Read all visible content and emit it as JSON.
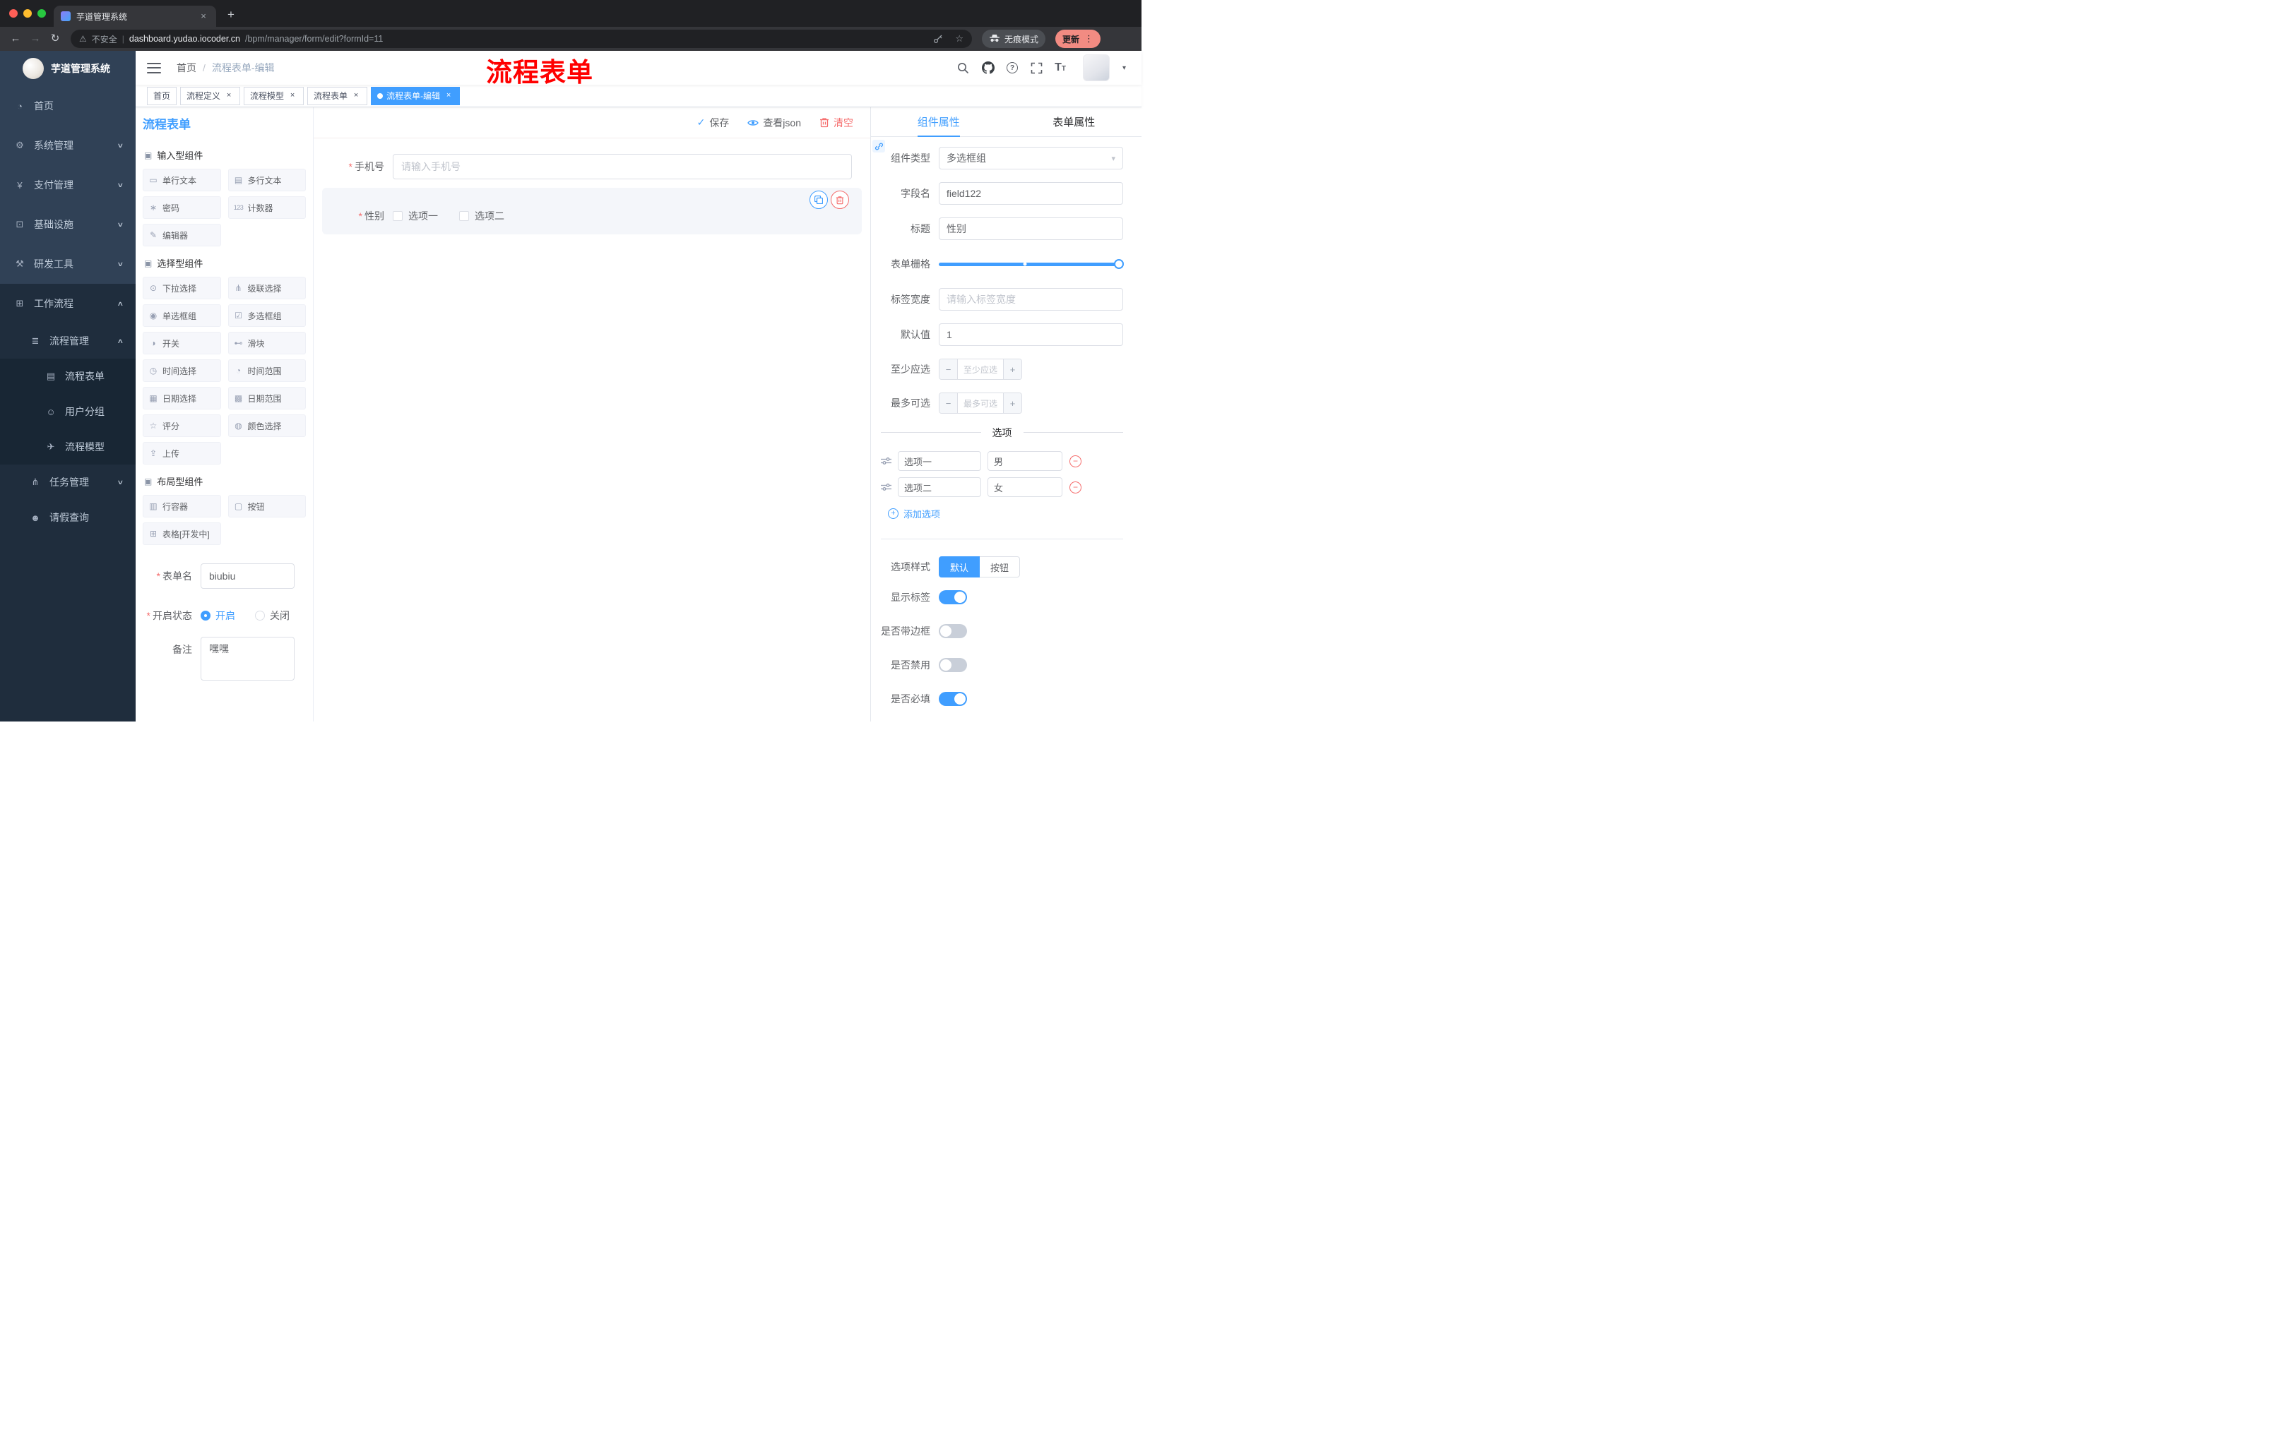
{
  "browser": {
    "tab_title": "芋道管理系统",
    "security_label": "不安全",
    "url_host": "dashboard.yudao.iocoder.cn",
    "url_path": "/bpm/manager/form/edit?formId=11",
    "incognito_label": "无痕模式",
    "update_label": "更新"
  },
  "annotation": {
    "text": "流程表单",
    "color": "#ff0000"
  },
  "icons": {
    "back": "←",
    "forward": "→",
    "reload": "↻",
    "new_tab": "+",
    "tab_close": "×",
    "tag_close": "×",
    "warning": "⚠",
    "star": "☆",
    "kebab": "⋮",
    "chevron_down": "∨",
    "chevron_up": "∧",
    "select_caret": "▾",
    "avatar_caret": "▾",
    "question": "?",
    "font_size_big": "T",
    "font_size_small": "T",
    "check": "✓",
    "minus": "−",
    "plus": "+",
    "group_marker": "▣",
    "url_divider": "|"
  },
  "sidebar": {
    "logo_title": "芋道管理系统",
    "items": [
      {
        "label": "首页",
        "icon": "dashboard-icon",
        "glyph": "◔"
      },
      {
        "label": "系统管理",
        "icon": "gear-icon",
        "glyph": "⚙"
      },
      {
        "label": "支付管理",
        "icon": "payment-icon",
        "glyph": "¥"
      },
      {
        "label": "基础设施",
        "icon": "infrastructure-icon",
        "glyph": "⊡"
      },
      {
        "label": "研发工具",
        "icon": "devtools-icon",
        "glyph": "⚒"
      },
      {
        "label": "工作流程",
        "icon": "workflow-icon",
        "glyph": "⊞"
      },
      {
        "label": "流程管理",
        "icon": "process-manage-icon",
        "glyph": "≣"
      },
      {
        "label": "流程表单",
        "icon": "process-form-icon",
        "glyph": "▤",
        "active": true
      },
      {
        "label": "用户分组",
        "icon": "user-group-icon",
        "glyph": "☺"
      },
      {
        "label": "流程模型",
        "icon": "process-model-icon",
        "glyph": "✈"
      },
      {
        "label": "任务管理",
        "icon": "task-manage-icon",
        "glyph": "⋔"
      },
      {
        "label": "请假查询",
        "icon": "leave-query-icon",
        "glyph": "☻"
      }
    ]
  },
  "breadcrumb": {
    "root": "首页",
    "separator": "/",
    "current": "流程表单-编辑"
  },
  "tags": [
    {
      "label": "首页",
      "closable": false,
      "active": false
    },
    {
      "label": "流程定义",
      "closable": true,
      "active": false
    },
    {
      "label": "流程模型",
      "closable": true,
      "active": false
    },
    {
      "label": "流程表单",
      "closable": true,
      "active": false
    },
    {
      "label": "流程表单-编辑",
      "closable": true,
      "active": true
    }
  ],
  "designer": {
    "panel_title": "流程表单",
    "actions": {
      "save": "保存",
      "view_json": "查看json",
      "clear": "清空"
    },
    "library": {
      "groups": [
        {
          "title": "输入型组件",
          "items": [
            {
              "label": "单行文本",
              "icon": "single-line-text-icon",
              "glyph": "▭"
            },
            {
              "label": "多行文本",
              "icon": "textarea-icon",
              "glyph": "▤"
            },
            {
              "label": "密码",
              "icon": "password-icon",
              "glyph": "∗"
            },
            {
              "label": "计数器",
              "icon": "counter-icon",
              "glyph": "123"
            },
            {
              "label": "编辑器",
              "icon": "editor-icon",
              "glyph": "✎"
            }
          ]
        },
        {
          "title": "选择型组件",
          "items": [
            {
              "label": "下拉选择",
              "icon": "select-icon",
              "glyph": "⊙"
            },
            {
              "label": "级联选择",
              "icon": "cascader-icon",
              "glyph": "⋔"
            },
            {
              "label": "单选框组",
              "icon": "radio-group-icon",
              "glyph": "◉"
            },
            {
              "label": "多选框组",
              "icon": "checkbox-group-icon",
              "glyph": "☑"
            },
            {
              "label": "开关",
              "icon": "switch-icon",
              "glyph": "◑"
            },
            {
              "label": "滑块",
              "icon": "slider-icon",
              "glyph": "⊷"
            },
            {
              "label": "时间选择",
              "icon": "time-picker-icon",
              "glyph": "◷"
            },
            {
              "label": "时间范围",
              "icon": "time-range-icon",
              "glyph": "◔"
            },
            {
              "label": "日期选择",
              "icon": "date-picker-icon",
              "glyph": "▦"
            },
            {
              "label": "日期范围",
              "icon": "date-range-icon",
              "glyph": "▩"
            },
            {
              "label": "评分",
              "icon": "rate-icon",
              "glyph": "☆"
            },
            {
              "label": "颜色选择",
              "icon": "color-picker-icon",
              "glyph": "◍"
            },
            {
              "label": "上传",
              "icon": "upload-icon",
              "glyph": "⇪"
            }
          ]
        },
        {
          "title": "布局型组件",
          "items": [
            {
              "label": "行容器",
              "icon": "row-container-icon",
              "glyph": "▥"
            },
            {
              "label": "按钮",
              "icon": "button-icon",
              "glyph": "▢"
            },
            {
              "label": "表格[开发中]",
              "icon": "table-icon",
              "glyph": "⊞"
            }
          ]
        }
      ]
    },
    "meta": {
      "required_mark": "*",
      "form_name_label": "表单名",
      "form_name_value": "biubiu",
      "status_label": "开启状态",
      "status_on": "开启",
      "status_off": "关闭",
      "remark_label": "备注",
      "remark_value": "嘿嘿"
    },
    "canvas": {
      "phone_label": "手机号",
      "phone_placeholder": "请输入手机号",
      "gender_label": "性别",
      "gender_options": [
        "选项一",
        "选项二"
      ]
    }
  },
  "props": {
    "tab_component": "组件属性",
    "tab_form": "表单属性",
    "component_type_label": "组件类型",
    "component_type_value": "多选框组",
    "field_name_label": "字段名",
    "field_name_value": "field122",
    "title_label": "标题",
    "title_value": "性别",
    "grid_label": "表单栅格",
    "label_width_label": "标签宽度",
    "label_width_placeholder": "请输入标签宽度",
    "default_label": "默认值",
    "default_value": "1",
    "min_label": "至少应选",
    "min_placeholder": "至少应选",
    "max_label": "最多可选",
    "max_placeholder": "最多可选",
    "options_title": "选项",
    "options": [
      {
        "label": "选项一",
        "value": "男"
      },
      {
        "label": "选项二",
        "value": "女"
      }
    ],
    "add_option_label": "添加选项",
    "style_label": "选项样式",
    "style_options": [
      "默认",
      "按钮"
    ],
    "switches": [
      {
        "label": "显示标签",
        "on": true
      },
      {
        "label": "是否带边框",
        "on": false
      },
      {
        "label": "是否禁用",
        "on": false
      },
      {
        "label": "是否必填",
        "on": true
      }
    ]
  },
  "colors": {
    "accent": "#409eff",
    "danger": "#f56c6c",
    "active_tag": "#409eff",
    "annotation": "#ff0000"
  }
}
